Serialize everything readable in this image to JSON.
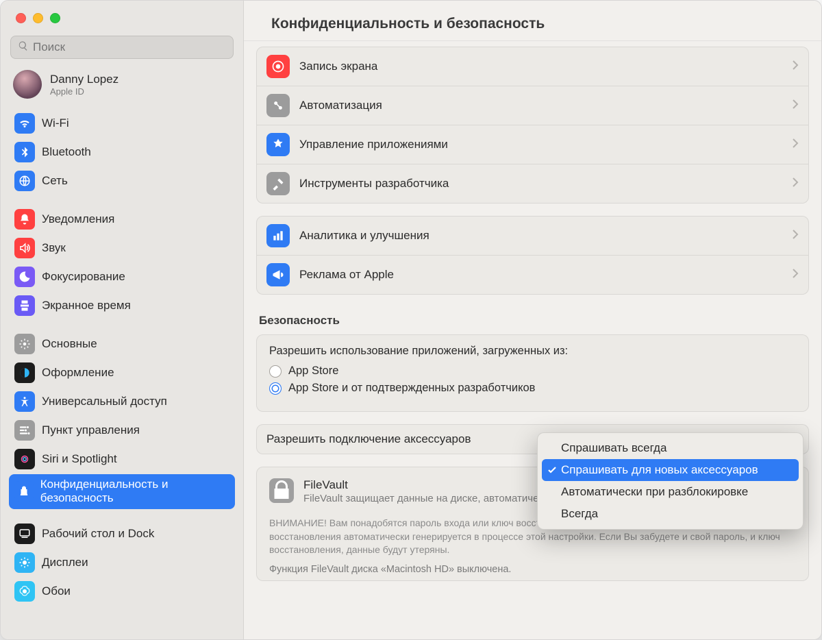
{
  "header": {
    "title": "Конфиденциальность и безопасность"
  },
  "search": {
    "placeholder": "Поиск"
  },
  "account": {
    "name": "Danny Lopez",
    "sub": "Apple ID"
  },
  "sidebar": {
    "groups": [
      [
        {
          "key": "wifi",
          "label": "Wi-Fi",
          "color": "#2f7bf4"
        },
        {
          "key": "bluetooth",
          "label": "Bluetooth",
          "color": "#2f7bf4"
        },
        {
          "key": "network",
          "label": "Сеть",
          "color": "#2f7bf4"
        }
      ],
      [
        {
          "key": "notifications",
          "label": "Уведомления",
          "color": "#ff4040"
        },
        {
          "key": "sound",
          "label": "Звук",
          "color": "#ff4040"
        },
        {
          "key": "focus",
          "label": "Фокусирование",
          "color": "#7a5af5"
        },
        {
          "key": "screentime",
          "label": "Экранное время",
          "color": "#6a5af5"
        }
      ],
      [
        {
          "key": "general",
          "label": "Основные",
          "color": "#9c9c9c"
        },
        {
          "key": "appearance",
          "label": "Оформление",
          "color": "#1c1c1c"
        },
        {
          "key": "accessibility",
          "label": "Универсальный доступ",
          "color": "#2f7bf4"
        },
        {
          "key": "controlcenter",
          "label": "Пункт управления",
          "color": "#9c9c9c"
        },
        {
          "key": "siri",
          "label": "Siri и Spotlight",
          "color": "#1c1c1c"
        },
        {
          "key": "privacy",
          "label": "Конфиденциальность и безопасность",
          "color": "#2f7bf4",
          "selected": true
        }
      ],
      [
        {
          "key": "desktop",
          "label": "Рабочий стол и Dock",
          "color": "#1c1c1c"
        },
        {
          "key": "displays",
          "label": "Дисплеи",
          "color": "#2fb4f4"
        },
        {
          "key": "wallpaper",
          "label": "Обои",
          "color": "#2fc4f4"
        }
      ]
    ]
  },
  "main": {
    "group1": [
      {
        "key": "screenrec",
        "label": "Запись экрана",
        "color": "#ff4040"
      },
      {
        "key": "automation",
        "label": "Автоматизация",
        "color": "#9c9c9c"
      },
      {
        "key": "appmgmt",
        "label": "Управление приложениями",
        "color": "#2f7bf4"
      },
      {
        "key": "devtools",
        "label": "Инструменты разработчика",
        "color": "#9c9c9c"
      }
    ],
    "group2": [
      {
        "key": "analytics",
        "label": "Аналитика и улучшения",
        "color": "#2f7bf4"
      },
      {
        "key": "ads",
        "label": "Реклама от Apple",
        "color": "#2f7bf4"
      }
    ],
    "security_title": "Безопасность",
    "allow_downloads_label": "Разрешить использование приложений, загруженных из:",
    "radio1": "App Store",
    "radio2": "App Store и от подтвержденных разработчиков",
    "accessory_label": "Разрешить подключение аксессуаров",
    "filevault": {
      "title": "FileVault",
      "desc": "FileVault защищает данные на диске, автоматически шифруя его содержимое.",
      "warn": "ВНИМАНИЕ! Вам понадобятся пароль входа или ключ восстановления для доступа к своим данным. Ключ восстановления автоматически генерируется в процессе этой настройки. Если Вы забудете и свой пароль, и ключ восстановления, данные будут утеряны.",
      "status": "Функция FileVault диска «Macintosh HD» выключена."
    }
  },
  "popup": {
    "items": [
      {
        "label": "Спрашивать всегда",
        "selected": false
      },
      {
        "label": "Спрашивать для новых аксессуаров",
        "selected": true
      },
      {
        "label": "Автоматически при разблокировке",
        "selected": false
      },
      {
        "label": "Всегда",
        "selected": false
      }
    ]
  }
}
